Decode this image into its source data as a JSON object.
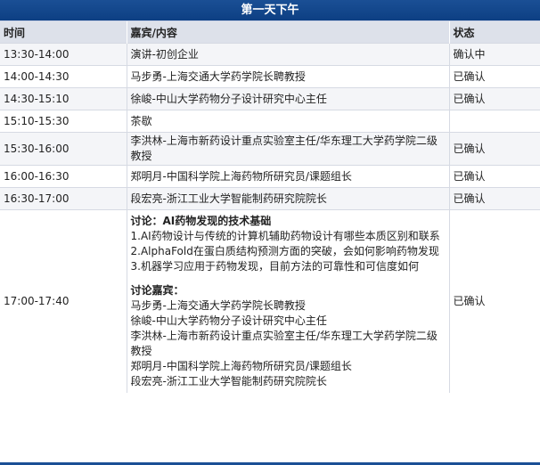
{
  "title": "第一天下午",
  "headers": {
    "time": "时间",
    "content": "嘉宾/内容",
    "status": "状态"
  },
  "rows": [
    {
      "time": "13:30-14:00",
      "content": "演讲-初创企业",
      "status": "确认中"
    },
    {
      "time": "14:00-14:30",
      "content": "马步勇-上海交通大学药学院长聘教授",
      "status": "已确认"
    },
    {
      "time": "14:30-15:10",
      "content": "徐峻-中山大学药物分子设计研究中心主任",
      "status": "已确认"
    },
    {
      "time": "15:10-15:30",
      "content": "茶歇",
      "status": ""
    },
    {
      "time": "15:30-16:00",
      "content": "李洪林-上海市新药设计重点实验室主任/华东理工大学药学院二级教授",
      "status": "已确认"
    },
    {
      "time": "16:00-16:30",
      "content": "郑明月-中国科学院上海药物所研究员/课题组长",
      "status": "已确认"
    },
    {
      "time": "16:30-17:00",
      "content": "段宏亮-浙江工业大学智能制药研究院院长",
      "status": "已确认"
    }
  ],
  "discussion": {
    "time": "17:00-17:40",
    "status": "已确认",
    "topic_title": "讨论：AI药物发现的技术基础",
    "topics": [
      "1.AI药物设计与传统的计算机辅助药物设计有哪些本质区别和联系",
      "2.AlphaFold在蛋白质结构预测方面的突破，会如何影响药物发现",
      "3.机器学习应用于药物发现，目前方法的可靠性和可信度如何"
    ],
    "guests_title": "讨论嘉宾：",
    "guests": [
      "马步勇-上海交通大学药学院长聘教授",
      "徐峻-中山大学药物分子设计研究中心主任",
      "李洪林-上海市新药设计重点实验室主任/华东理工大学药学院二级教授",
      "郑明月-中国科学院上海药物所研究员/课题组长",
      "段宏亮-浙江工业大学智能制药研究院院长"
    ]
  },
  "colors": {
    "title_bg": "#0d3f83",
    "header_bg": "#dde1ea",
    "row_alt": "#f4f5f8"
  }
}
